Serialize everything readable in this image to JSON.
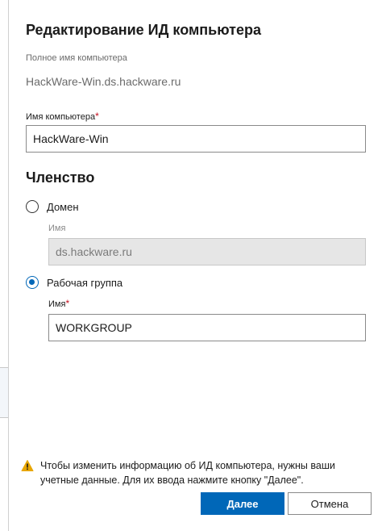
{
  "dialog": {
    "title": "Редактирование ИД компьютера",
    "full_name_label": "Полное имя компьютера",
    "full_name_value": "HackWare-Win.ds.hackware.ru",
    "computer_name_label": "Имя компьютера",
    "required_mark": "*",
    "computer_name_value": "HackWare-Win"
  },
  "membership": {
    "title": "Членство",
    "domain": {
      "label": "Домен",
      "selected": false,
      "name_label": "Имя",
      "name_value": "ds.hackware.ru"
    },
    "workgroup": {
      "label": "Рабочая группа",
      "selected": true,
      "name_label": "Имя",
      "required_mark": "*",
      "name_value": "WORKGROUP"
    }
  },
  "warning": {
    "icon": "warning-icon",
    "icon_color": "#e8a600",
    "text_line1": "Чтобы изменить информацию об ИД компьютера, нужны ваши",
    "text_line2": "учетные данные. Для их ввода нажмите кнопку \"Далее\"."
  },
  "buttons": {
    "next_label": "Далее",
    "cancel_label": "Отмена"
  },
  "colors": {
    "accent": "#0067b8",
    "required": "#c50f1f"
  }
}
